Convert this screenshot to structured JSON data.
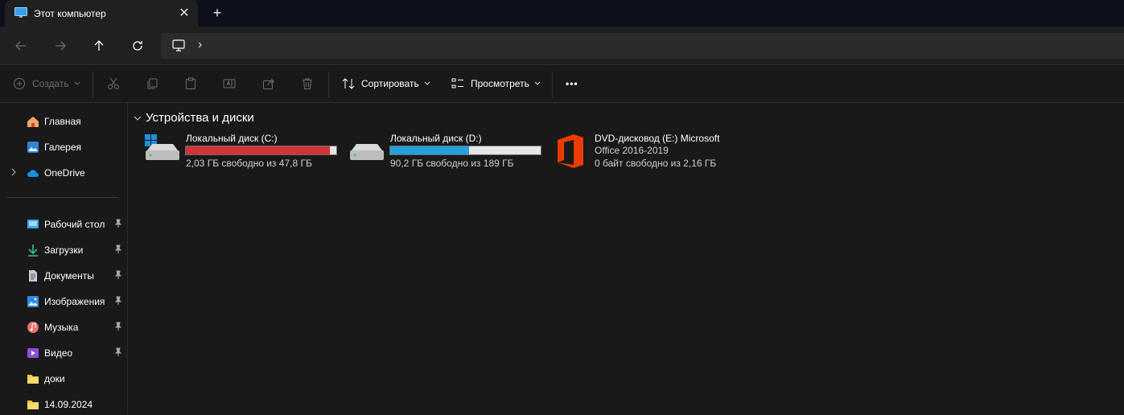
{
  "window": {
    "tab_title": "Этот компьютер",
    "new_tab": "+",
    "close": "✕"
  },
  "nav": {
    "back_icon": "arrow-left-icon",
    "forward_icon": "arrow-right-icon",
    "up_icon": "arrow-up-icon",
    "refresh_icon": "refresh-icon",
    "location_icon": "monitor-icon",
    "breadcrumb_chevron": "›"
  },
  "toolbar": {
    "new_label": "Создать",
    "sort_label": "Сортировать",
    "view_label": "Просмотреть",
    "more_label": "•••"
  },
  "sidebar": {
    "items": [
      {
        "label": "Главная",
        "icon": "home-icon"
      },
      {
        "label": "Галерея",
        "icon": "gallery-icon"
      },
      {
        "label": "OneDrive",
        "icon": "cloud-icon"
      }
    ],
    "pinned": [
      {
        "label": "Рабочий стол",
        "icon": "desktop-icon",
        "pinned": true
      },
      {
        "label": "Загрузки",
        "icon": "download-icon",
        "pinned": true
      },
      {
        "label": "Документы",
        "icon": "document-icon",
        "pinned": true
      },
      {
        "label": "Изображения",
        "icon": "pictures-icon",
        "pinned": true
      },
      {
        "label": "Музыка",
        "icon": "music-icon",
        "pinned": true
      },
      {
        "label": "Видео",
        "icon": "video-icon",
        "pinned": true
      },
      {
        "label": "доки",
        "icon": "folder-icon",
        "pinned": false
      },
      {
        "label": "14.09.2024",
        "icon": "folder-icon",
        "pinned": false
      }
    ]
  },
  "main": {
    "group_title": "Устройства и диски",
    "drives": [
      {
        "name": "Локальный диск (C:)",
        "free": "2,03 ГБ свободно из 47,8 ГБ",
        "used_fraction": 0.958,
        "bar_color": "#d13438"
      },
      {
        "name": "Локальный диск (D:)",
        "free": "90,2 ГБ свободно из 189 ГБ",
        "used_fraction": 0.523,
        "bar_color": "#26a0da"
      },
      {
        "name_line1": "DVD-дисковод (E:) Microsoft",
        "name_line2": "Office 2016-2019",
        "free": "0 байт свободно из 2,16 ГБ"
      }
    ]
  },
  "colors": {
    "accent": "#60cdff",
    "office": "#eb3c00"
  }
}
